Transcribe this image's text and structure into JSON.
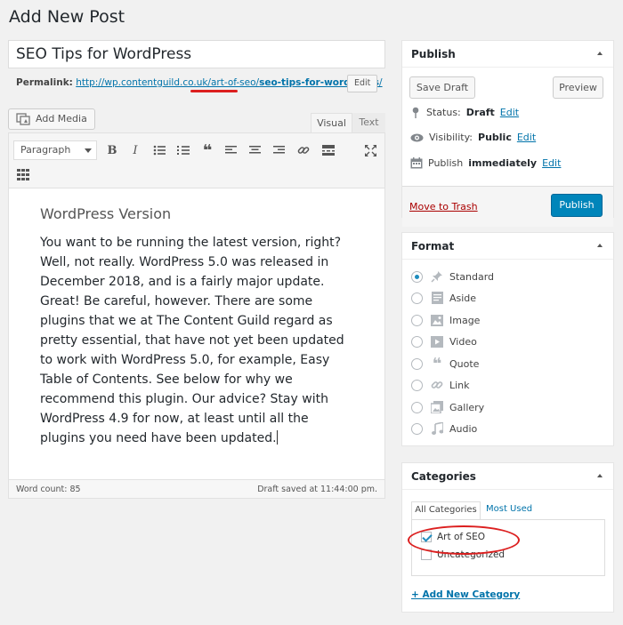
{
  "page": {
    "title": "Add New Post"
  },
  "post": {
    "title": "SEO Tips for WordPress",
    "permalink_label": "Permalink:",
    "permalink_base": "http://wp.contentguild.co.uk/",
    "permalink_cat": "art-of-seo",
    "permalink_sep": "/",
    "permalink_slug": "seo-tips-for-wordpress",
    "permalink_end": "/",
    "permalink_edit": "Edit"
  },
  "editor": {
    "add_media": "Add Media",
    "tab_visual": "Visual",
    "tab_text": "Text",
    "format_select": "Paragraph",
    "heading": "WordPress Version",
    "body_1": "You want to be running the latest version, right? Well, not really. WordPress 5.0 was released in December 2018, and is a fairly major update. Great! Be careful, however. There are some plugins that we at The Content Guild regard as pretty essential, that have not yet been updated to work with WordPress 5.0, for example, ",
    "body_link": "Easy Table of Contents",
    "body_2": ". See below for why we recommend this plugin. Our advice? Stay with WordPress 4.9 for now, at least until all the plugins you need have been updated.",
    "word_count": "Word count: 85",
    "draft_saved": "Draft saved at 11:44:00 pm."
  },
  "publish": {
    "title": "Publish",
    "save_draft": "Save Draft",
    "preview": "Preview",
    "status_label": "Status:",
    "status_value": "Draft",
    "visibility_label": "Visibility:",
    "visibility_value": "Public",
    "publish_label": "Publish",
    "publish_value": "immediately",
    "edit": "Edit",
    "move_to_trash": "Move to Trash",
    "publish_button": "Publish"
  },
  "format": {
    "title": "Format",
    "options": [
      "Standard",
      "Aside",
      "Image",
      "Video",
      "Quote",
      "Link",
      "Gallery",
      "Audio"
    ],
    "selected": "Standard"
  },
  "categories": {
    "title": "Categories",
    "tab_all": "All Categories",
    "tab_used": "Most Used",
    "items": [
      "Art of SEO",
      "Uncategorized"
    ],
    "add_new": "+ Add New Category"
  },
  "colors": {
    "accent": "#0085ba",
    "annotation": "#dc1f1f",
    "link": "#0073aa"
  }
}
